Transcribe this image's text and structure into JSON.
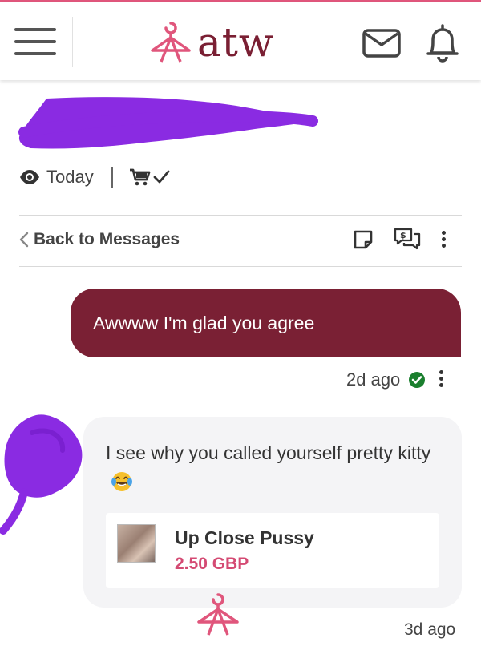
{
  "header": {
    "brand": "atw",
    "menu_icon": "hamburger-menu-icon",
    "logo_icon": "hanger-logo-icon",
    "mail_icon": "envelope-icon",
    "bell_icon": "bell-icon"
  },
  "conversation": {
    "seen_label": "Today",
    "seen_icon": "eye-icon",
    "cart_icon": "cart-check-icon"
  },
  "toolbar": {
    "back_label": "Back to Messages",
    "note_icon": "note-icon",
    "offer_icon": "chat-dollar-icon",
    "more_icon": "more-vertical-icon"
  },
  "messages": [
    {
      "direction": "outgoing",
      "text": "Awwww I'm glad you agree",
      "time": "2d ago",
      "status_icon": "delivered-check-icon"
    },
    {
      "direction": "incoming",
      "text": "I see why you called yourself pretty kitty",
      "emoji": "face-with-tears-of-joy",
      "product": {
        "title": "Up Close Pussy",
        "price": "2.50 GBP"
      },
      "time": "3d ago"
    }
  ],
  "colors": {
    "accent_pink": "#e0567c",
    "brand_maroon": "#7a1f33",
    "outgoing_bubble": "#7a2034",
    "incoming_bubble": "#f4f4f6",
    "price_pink": "#d44a73",
    "verified_green": "#1a7f2e",
    "redaction_purple": "#8a2be2"
  }
}
